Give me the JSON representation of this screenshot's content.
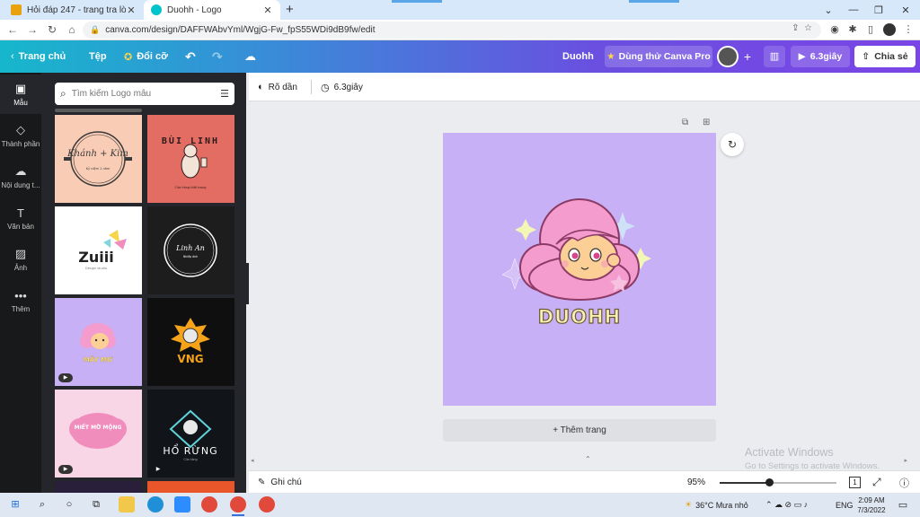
{
  "browser": {
    "tabs": [
      {
        "title": "Hỏi đáp 247 - trang tra lời",
        "favicon_color": "#e8a20d"
      },
      {
        "title": "Duohh - Logo",
        "favicon_color": "#00c4cc"
      }
    ],
    "url": "canva.com/design/DAFFWAbvYml/WgjG-Fw_fpS55WDi9dB9fw/edit"
  },
  "canva_bar": {
    "home": "Trang chủ",
    "file": "Tệp",
    "resize": "Đổi cỡ",
    "doc_title": "Duohh",
    "try_pro": "Dùng thử Canva Pro",
    "play": "6.3giây",
    "share": "Chia sẻ"
  },
  "rail": [
    {
      "label": "Mẫu",
      "icon": "template-icon",
      "glyph": "▣"
    },
    {
      "label": "Thành phần",
      "icon": "elements-icon",
      "glyph": "◇"
    },
    {
      "label": "Nội dung t...",
      "icon": "upload-icon",
      "glyph": "☁"
    },
    {
      "label": "Văn bản",
      "icon": "text-icon",
      "glyph": "T"
    },
    {
      "label": "Ảnh",
      "icon": "photo-icon",
      "glyph": "▨"
    },
    {
      "label": "Thêm",
      "icon": "more-icon",
      "glyph": "•••"
    }
  ],
  "search": {
    "placeholder": "Tìm kiếm Logo mẫu"
  },
  "templates": [
    {
      "name": "Khánh + Kim",
      "sub": "Kỷ niệm 1 năm",
      "bg": "#f9ccb5",
      "fg": "#3a3a3a"
    },
    {
      "name": "BÙI LINH",
      "sub": "Cửa hàng thời trang",
      "bg": "#e46d63",
      "fg": "#2a1a1a"
    },
    {
      "name": "Zuiii",
      "sub": "Design studio",
      "bg": "#ffffff",
      "fg": "#222222"
    },
    {
      "name": "Linh An",
      "sub": "Nhiếp ảnh",
      "bg": "#1d1d1d",
      "fg": "#ffffff"
    },
    {
      "name": "MÂY MƠ",
      "sub": "",
      "bg": "#c7b0f5",
      "fg": "#f4e97a"
    },
    {
      "name": "VNG",
      "sub": "",
      "bg": "#0f0f0f",
      "fg": "#f5a31a"
    },
    {
      "name": "MIẾT MỜ MỘNG",
      "sub": "",
      "bg": "#f8d6e6",
      "fg": "#ffffff"
    },
    {
      "name": "HỔ RỪNG",
      "sub": "Cửa hàng",
      "bg": "#111418",
      "fg": "#ffffff"
    }
  ],
  "editor": {
    "animate": "Rõ dần",
    "duration": "6.3giây",
    "logo_text": "DUOHH",
    "add_page": "+ Thêm trang",
    "notes": "Ghi chú",
    "zoom": "95%",
    "zoom_fraction": 0.42,
    "page_count": "1"
  },
  "watermark": {
    "line1": "Activate Windows",
    "line2": "Go to Settings to activate Windows."
  },
  "taskbar": {
    "weather": "36°C  Mưa nhỏ",
    "lang": "ENG",
    "time": "2:09 AM",
    "date": "7/3/2022"
  },
  "colors": {
    "canvas_bg": "#c7b0f5",
    "hair": "#f39ccd",
    "face": "#fbcf96",
    "logo_text": "#f7f0b8"
  }
}
